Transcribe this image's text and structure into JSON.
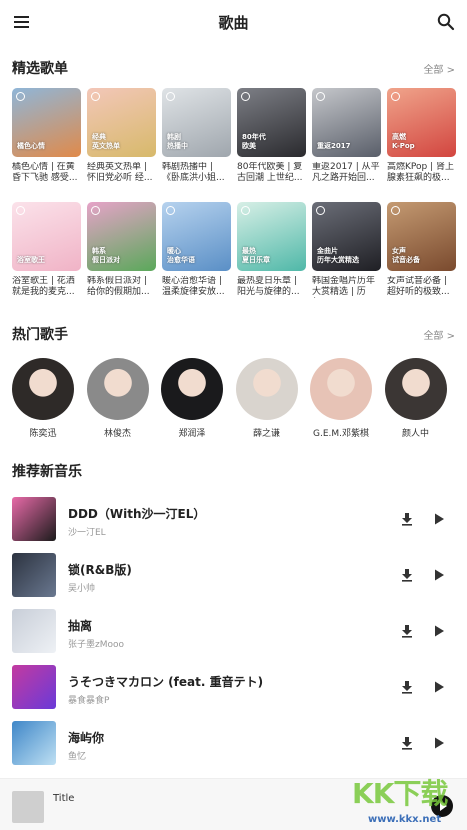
{
  "header": {
    "title": "歌曲"
  },
  "featured": {
    "title": "精选歌单",
    "more": "全部 >",
    "playlists": [
      {
        "tag": "橘色心情",
        "name": "橘色心情 | 在黄昏下飞驰 感受...",
        "color": "#e08a4a",
        "color2": "#8fb6d8"
      },
      {
        "tag": "经典\n英文热单",
        "name": "经典英文热单 | 怀旧党必听 经...",
        "color": "#d7b96a",
        "color2": "#f3c7b9"
      },
      {
        "tag": "韩剧\n热播中",
        "name": "韩剧热播中 | 《卧底洪小姐...",
        "color": "#9fa6ad",
        "color2": "#dfe3e6"
      },
      {
        "tag": "80年代\n欧美",
        "name": "80年代欧美 | 复古回潮 上世纪...",
        "color": "#2a2a2e",
        "color2": "#7d7f86"
      },
      {
        "tag": "重返2017",
        "name": "重返2017 | 从平凡之路开始回...",
        "color": "#595e69",
        "color2": "#c5c7cb"
      },
      {
        "tag": "高燃\nK-Pop",
        "name": "高燃KPop | 肾上腺素狂飙的极...",
        "color": "#d2453f",
        "color2": "#f0a48b"
      },
      {
        "tag": "浴室歌王",
        "name": "浴室歌王 | 花洒就是我的麦克...",
        "color": "#f0b3c6",
        "color2": "#fbe2ea"
      },
      {
        "tag": "韩系\n假日派对",
        "name": "韩系假日派对 | 给你的假期加...",
        "color": "#5aa85a",
        "color2": "#e6a3c8"
      },
      {
        "tag": "暖心\n治愈华语",
        "name": "暖心治愈华语 | 温柔旋律安放...",
        "color": "#5a8fc6",
        "color2": "#b6d2ee"
      },
      {
        "tag": "最热\n夏日乐章",
        "name": "最热夏日乐章 | 阳光与旋律的...",
        "color": "#4fb8a8",
        "color2": "#d7efe6"
      },
      {
        "tag": "金曲片\n历年大赏精选",
        "name": "韩国金唱片历年大赏精选 | 历年...",
        "color": "#1f1f24",
        "color2": "#6b6e78"
      },
      {
        "tag": "女声\n试音必备",
        "name": "女声试音必备 | 超好听的极致...",
        "color": "#7a4a2e",
        "color2": "#c49a72"
      }
    ]
  },
  "artists": {
    "title": "热门歌手",
    "more": "全部 >",
    "items": [
      {
        "name": "陈奕迅",
        "color": "#2e2a28"
      },
      {
        "name": "林俊杰",
        "color": "#8a8a8a"
      },
      {
        "name": "郑润泽",
        "color": "#1a1a1c"
      },
      {
        "name": "薛之谦",
        "color": "#d9d4ce"
      },
      {
        "name": "G.E.M.邓紫棋",
        "color": "#e7c3b6"
      },
      {
        "name": "颜人中",
        "color": "#3b3634"
      }
    ]
  },
  "new_music": {
    "title": "推荐新音乐",
    "songs": [
      {
        "title": "DDD（With沙一汀EL）",
        "artist": "沙一汀EL",
        "color": "#e86aa8",
        "color2": "#1b1b1b"
      },
      {
        "title": "锁(R&B版)",
        "artist": "吴小帅",
        "color": "#2c3340",
        "color2": "#6a7890"
      },
      {
        "title": "抽离",
        "artist": "张子墨zMooo",
        "color": "#c8ced8",
        "color2": "#eef1f5"
      },
      {
        "title": "うそつきマカロン (feat. 重音テト)",
        "artist": "暴食暴食P",
        "color": "#c33aa0",
        "color2": "#6a3ad8"
      },
      {
        "title": "海屿你",
        "artist": "鱼忆",
        "color": "#3f87c8",
        "color2": "#bfe0f3"
      }
    ]
  },
  "player": {
    "title": "Title"
  },
  "watermark": {
    "big": "KK下载",
    "small": "www.kkx.net"
  }
}
